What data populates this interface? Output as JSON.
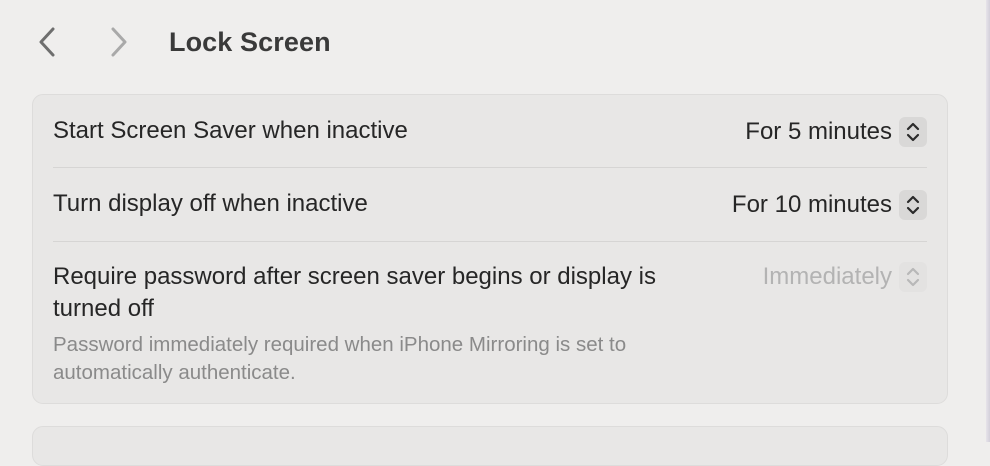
{
  "toolbar": {
    "title": "Lock Screen",
    "back_icon": "chevron-left-icon",
    "forward_icon": "chevron-right-icon"
  },
  "settings": {
    "rows": [
      {
        "label": "Start Screen Saver when inactive",
        "value": "For 5 minutes",
        "enabled": true
      },
      {
        "label": "Turn display off when inactive",
        "value": "For 10 minutes",
        "enabled": true
      },
      {
        "label": "Require password after screen saver begins or display is turned off",
        "description": "Password immediately required when iPhone Mirroring is set to automatically authenticate.",
        "value": "Immediately",
        "enabled": false
      }
    ]
  },
  "colors": {
    "background": "#efeeed",
    "panel": "#e8e7e6",
    "text": "#262626",
    "secondary_text": "#8a8a8a",
    "disabled_text": "#b3b3b3"
  }
}
